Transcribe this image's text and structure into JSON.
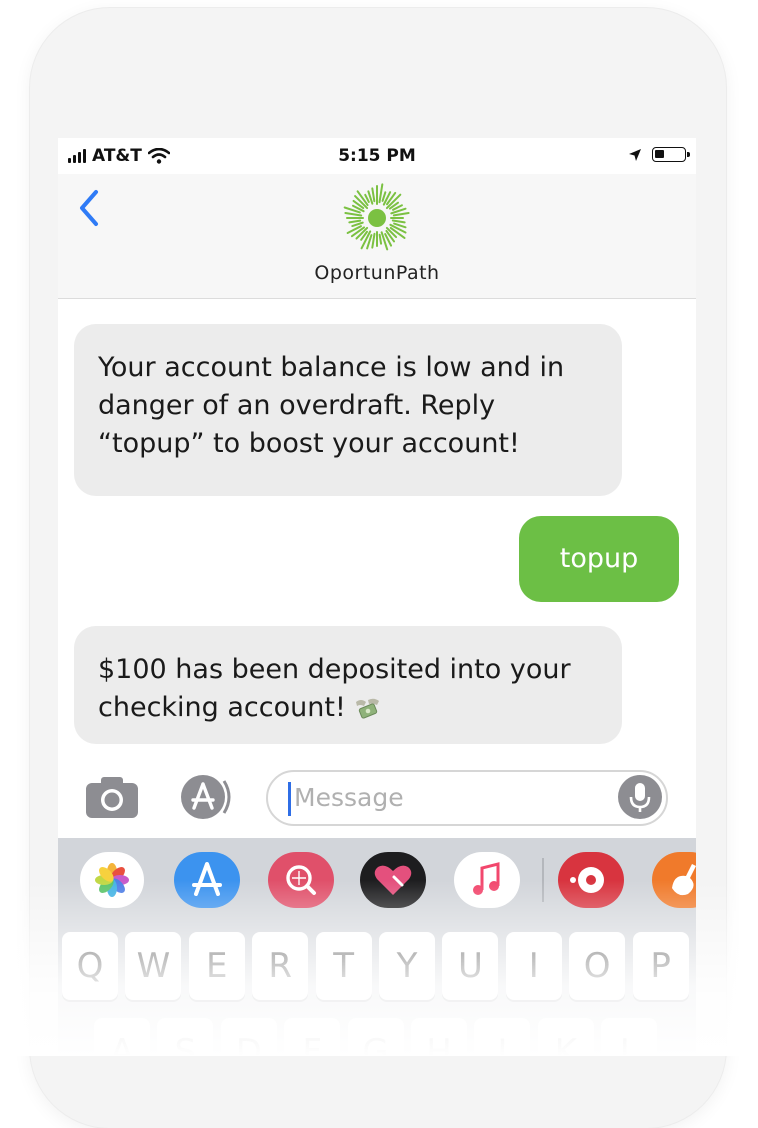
{
  "status_bar": {
    "carrier": "AT&T",
    "time": "5:15 PM"
  },
  "header": {
    "contact_name": "OportunPath",
    "back_icon": "chevron-left-icon",
    "logo_icon": "sunburst-logo-icon",
    "accent_color": "#7bc142",
    "link_color": "#2f7bf6"
  },
  "messages": [
    {
      "direction": "incoming",
      "text": "Your account balance is low and in danger of an overdraft. Reply “topup” to boost your account!"
    },
    {
      "direction": "outgoing",
      "text": "topup",
      "color": "#6cbf45"
    },
    {
      "direction": "incoming",
      "text": "$100 has been deposited into your checking account!",
      "emoji": "money-with-wings-icon"
    }
  ],
  "input": {
    "placeholder": "Message",
    "camera_icon": "camera-icon",
    "apps_icon": "app-store-icon",
    "mic_icon": "microphone-icon"
  },
  "app_drawer": [
    "photos-icon",
    "app-store-icon",
    "web-search-icon",
    "digital-touch-icon",
    "music-icon",
    "music-memo-icon",
    "garageband-icon"
  ],
  "keyboard": {
    "row1": [
      "Q",
      "W",
      "E",
      "R",
      "T",
      "Y",
      "U",
      "I",
      "O",
      "P"
    ],
    "row2": [
      "A",
      "S",
      "D",
      "F",
      "G",
      "H",
      "J",
      "K",
      "L"
    ]
  }
}
